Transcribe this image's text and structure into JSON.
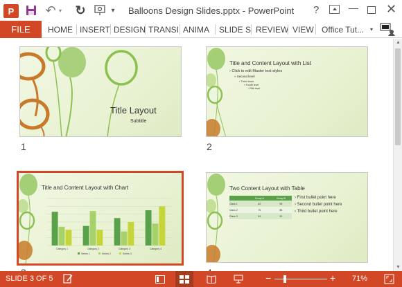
{
  "app": {
    "logo_letter": "P",
    "document_title": "Balloons Design Slides.pptx - PowerPoint",
    "help_label": "?"
  },
  "ribbon": {
    "file_label": "FILE",
    "tabs": [
      "HOME",
      "INSERT",
      "DESIGN",
      "TRANSI",
      "ANIMA",
      "SLIDE S",
      "REVIEW",
      "VIEW"
    ],
    "account_name": "Office Tut..."
  },
  "slides": [
    {
      "number": "1",
      "title": "Title Layout",
      "subtitle": "Subtitle"
    },
    {
      "number": "2",
      "title": "Title and Content Layout with List",
      "bullets": [
        "Click to edit Master text styles",
        "Second level",
        "Third level",
        "Fourth level",
        "Fifth level"
      ]
    },
    {
      "number": "3",
      "title": "Title and Content Layout with Chart",
      "selected": true,
      "chart_categories": [
        "Category 1",
        "Category 2",
        "Category 3",
        "Category 4"
      ],
      "chart_legend": [
        "Series 1",
        "Series 2",
        "Series 3"
      ]
    },
    {
      "number": "4",
      "title": "Two Content Layout with Table",
      "table_headers": [
        "",
        "Group A",
        "Group B"
      ],
      "table_rows": [
        [
          "Class 1",
          "82",
          "95"
        ],
        [
          "Class 2",
          "76",
          "88"
        ],
        [
          "Class 3",
          "84",
          "90"
        ]
      ],
      "bullets": [
        "First bullet point here",
        "Second bullet point here",
        "Third bullet point here"
      ]
    }
  ],
  "chart_data": {
    "type": "bar",
    "categories": [
      "Category 1",
      "Category 2",
      "Category 3",
      "Category 4"
    ],
    "series": [
      {
        "name": "Series 1",
        "values": [
          4.3,
          2.5,
          3.5,
          4.5
        ],
        "color": "#5aa24a"
      },
      {
        "name": "Series 2",
        "values": [
          2.4,
          4.4,
          1.8,
          2.8
        ],
        "color": "#a7d169"
      },
      {
        "name": "Series 3",
        "values": [
          2.0,
          2.0,
          3.0,
          5.0
        ],
        "color": "#c6d63a"
      }
    ],
    "ylim": [
      0,
      6
    ],
    "grid": true,
    "legend": "bottom"
  },
  "statusbar": {
    "slide_indicator": "SLIDE 3 OF 5",
    "zoom_level": "71%",
    "zoom_fraction": 0.2
  },
  "colors": {
    "accent": "#d24726",
    "slide_green": "#e9f2d3",
    "balloon_green": "#8cc152",
    "balloon_orange": "#c87a2a"
  }
}
